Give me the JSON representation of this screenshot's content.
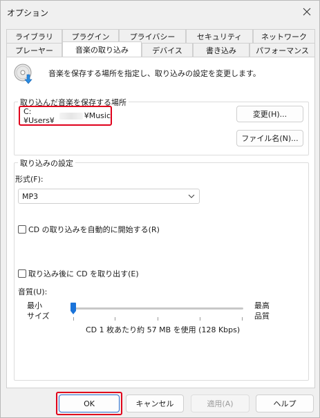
{
  "window": {
    "title": "オプション"
  },
  "tabs_row1": [
    "ライブラリ",
    "プラグイン",
    "プライバシー",
    "セキュリティ",
    "ネットワーク"
  ],
  "tabs_row2": [
    "プレーヤー",
    "音楽の取り込み",
    "デバイス",
    "書き込み",
    "パフォーマンス"
  ],
  "active_tab": "音楽の取り込み",
  "intro": "音楽を保存する場所を指定し、取り込みの設定を変更します。",
  "save_location": {
    "group_title": "取り込んだ音楽を保存する場所",
    "path_prefix": "C:¥Users¥",
    "path_suffix": "¥Music",
    "change_button": "変更(H)...",
    "filename_button": "ファイル名(N)..."
  },
  "rip_settings": {
    "group_title": "取り込みの設定",
    "format_label": "形式(F):",
    "format_value": "MP3",
    "auto_rip_label": "CD の取り込みを自動的に開始する(R)",
    "auto_rip_checked": false,
    "eject_label": "取り込み後に CD を取り出す(E)",
    "eject_checked": false,
    "quality_label": "音質(U):",
    "min_label_1": "最小",
    "min_label_2": "サイズ",
    "max_label_1": "最高",
    "max_label_2": "品質",
    "quality_level": 0,
    "quality_text": "CD 1 枚あたり約 57 MB を使用 (128 Kbps)"
  },
  "buttons": {
    "ok": "OK",
    "cancel": "キャンセル",
    "apply": "適用(A)",
    "help": "ヘルプ"
  },
  "colors": {
    "highlight": "#e0001b",
    "accent": "#1a73d9"
  },
  "icons": {
    "close": "close-icon",
    "disc": "cd-rip-icon",
    "chevron": "chevron-down-icon"
  }
}
